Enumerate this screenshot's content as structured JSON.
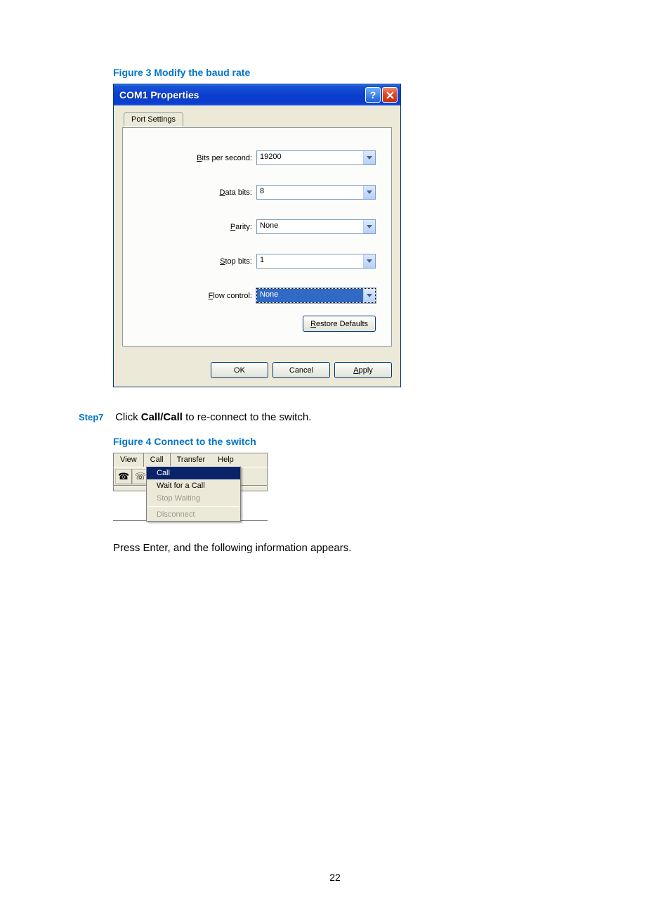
{
  "figure3": {
    "caption": "Figure 3 Modify the baud rate"
  },
  "dialog": {
    "title": "COM1 Properties",
    "help_symbol": "?",
    "close_symbol": "X",
    "tab": "Port Settings",
    "fields": {
      "bits_per_second": {
        "label_pre": "B",
        "label_rest": "its per second:",
        "value": "19200"
      },
      "data_bits": {
        "label_pre": "D",
        "label_rest": "ata bits:",
        "value": "8"
      },
      "parity": {
        "label_pre": "P",
        "label_rest": "arity:",
        "value": "None"
      },
      "stop_bits": {
        "label_pre": "S",
        "label_rest": "top bits:",
        "value": "1"
      },
      "flow_control": {
        "label_pre": "F",
        "label_rest": "low control:",
        "value": "None"
      }
    },
    "restore": {
      "pre": "R",
      "rest": "estore Defaults"
    },
    "ok": "OK",
    "cancel": "Cancel",
    "apply": {
      "pre": "A",
      "rest": "pply"
    }
  },
  "step7": {
    "label": "Step7",
    "text_before": "Click ",
    "bold": "Call/Call",
    "text_after": " to re-connect to the switch."
  },
  "figure4": {
    "caption": "Figure 4 Connect to the switch",
    "menubar": [
      "View",
      "Call",
      "Transfer",
      "Help"
    ],
    "dropdown": {
      "call": "Call",
      "wait": "Wait for a Call",
      "stop": "Stop Waiting",
      "disconnect": "Disconnect"
    }
  },
  "bodytext": "Press Enter, and the following information appears.",
  "page_number": "22"
}
